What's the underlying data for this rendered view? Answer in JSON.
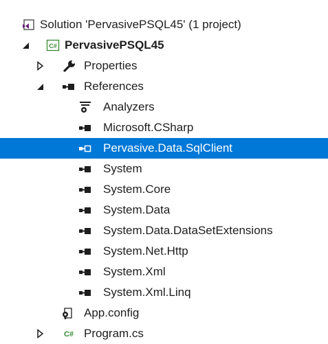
{
  "tree": {
    "solution_label": "Solution 'PervasivePSQL45' (1 project)",
    "project_label": "PervasivePSQL45",
    "properties_label": "Properties",
    "references_label": "References",
    "references": [
      {
        "label": "Analyzers",
        "icon": "analyzers-icon",
        "selected": false
      },
      {
        "label": "Microsoft.CSharp",
        "icon": "reference-icon",
        "selected": false
      },
      {
        "label": "Pervasive.Data.SqlClient",
        "icon": "reference-icon",
        "selected": true
      },
      {
        "label": "System",
        "icon": "reference-icon",
        "selected": false
      },
      {
        "label": "System.Core",
        "icon": "reference-icon",
        "selected": false
      },
      {
        "label": "System.Data",
        "icon": "reference-icon",
        "selected": false
      },
      {
        "label": "System.Data.DataSetExtensions",
        "icon": "reference-icon",
        "selected": false
      },
      {
        "label": "System.Net.Http",
        "icon": "reference-icon",
        "selected": false
      },
      {
        "label": "System.Xml",
        "icon": "reference-icon",
        "selected": false
      },
      {
        "label": "System.Xml.Linq",
        "icon": "reference-icon",
        "selected": false
      }
    ],
    "appconfig_label": "App.config",
    "program_label": "Program.cs",
    "project_badge": "C#",
    "program_badge": "C#"
  },
  "colors": {
    "selection": "#0078d7",
    "csharp_green": "#388a34",
    "vs_purple": "#68217a",
    "text": "#1e1e1e"
  }
}
